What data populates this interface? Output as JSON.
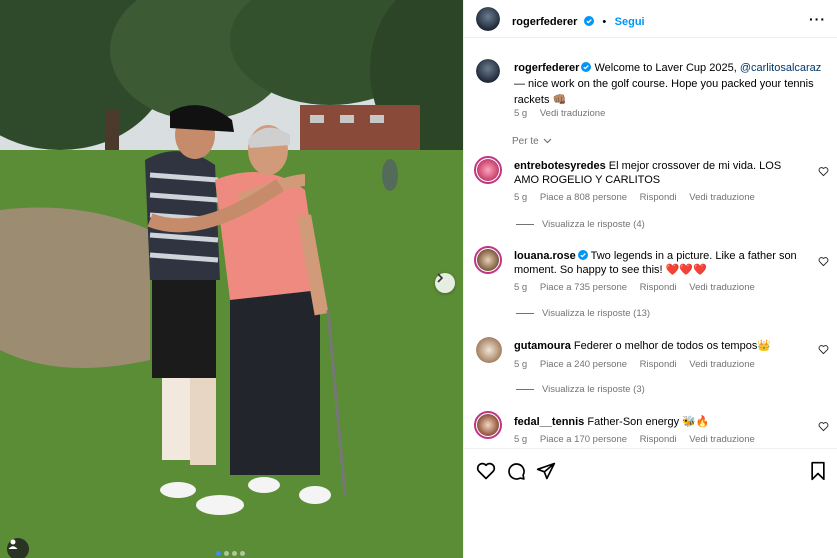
{
  "post": {
    "author": "rogerfederer",
    "follow_label": "Segui",
    "more_icon": "more-horizontal-icon",
    "caption_text": "Welcome to Laver Cup 2025, ",
    "caption_mention": "@carlitosalcaraz",
    "caption_rest": " — nice work on the golf course. Hope you packed your tennis rackets 👊🏽",
    "caption_age": "5 g",
    "caption_translate": "Vedi traduzione",
    "sort_label": "Per te"
  },
  "comments": [
    {
      "user": "entrebotesyredes",
      "verified": false,
      "text": "El mejor crossover de mi vida. LOS AMO ROGELIO Y CARLITOS",
      "age": "5 g",
      "likes": "Piace a 808 persone",
      "reply": "Rispondi",
      "translate": "Vedi traduzione",
      "view_replies": "Visualizza le risposte (4)"
    },
    {
      "user": "louana.rose",
      "verified": true,
      "text": "Two legends in a picture. Like a father son moment. So happy to see this! ❤️❤️❤️",
      "age": "5 g",
      "likes": "Piace a 735 persone",
      "reply": "Rispondi",
      "translate": "Vedi traduzione",
      "view_replies": "Visualizza le risposte (13)"
    },
    {
      "user": "gutamoura",
      "verified": false,
      "text": "Federer o melhor de todos os tempos👑",
      "age": "5 g",
      "likes": "Piace a 240 persone",
      "reply": "Rispondi",
      "translate": "Vedi traduzione",
      "view_replies": "Visualizza le risposte (3)"
    },
    {
      "user": "fedal__tennis",
      "verified": false,
      "text": "Father-Son energy 🐝🔥",
      "age": "5 g",
      "likes": "Piace a 170 persone",
      "reply": "Rispondi",
      "translate": "Vedi traduzione",
      "view_replies": ""
    }
  ],
  "carousel": {
    "current": 1,
    "total": 4
  },
  "colors": {
    "link": "#0095f6",
    "mention": "#00376b",
    "muted": "#737373",
    "verified": "#0095f6"
  }
}
